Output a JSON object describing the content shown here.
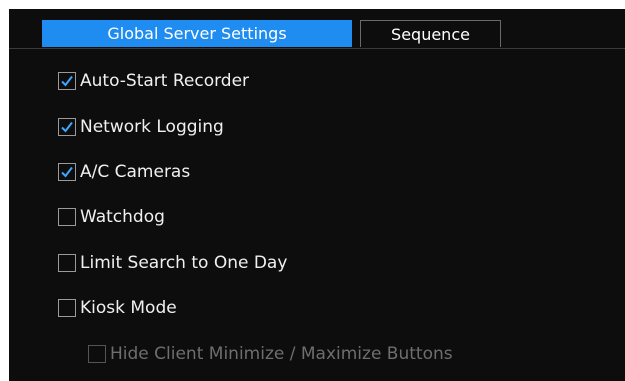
{
  "tabs": [
    {
      "label": "Global Server Settings",
      "active": true
    },
    {
      "label": "Sequence",
      "active": false
    }
  ],
  "options": [
    {
      "label": "Auto-Start Recorder",
      "checked": true,
      "enabled": true
    },
    {
      "label": "Network Logging",
      "checked": true,
      "enabled": true
    },
    {
      "label": "A/C Cameras",
      "checked": true,
      "enabled": true
    },
    {
      "label": "Watchdog",
      "checked": false,
      "enabled": true
    },
    {
      "label": "Limit Search to One Day",
      "checked": false,
      "enabled": true
    },
    {
      "label": "Kiosk Mode",
      "checked": false,
      "enabled": true
    },
    {
      "label": "Hide Client Minimize / Maximize Buttons",
      "checked": false,
      "enabled": false
    }
  ],
  "colors": {
    "background": "#0d0d0d",
    "active_tab": "#1e8cf0",
    "checkmark": "#3ea6ff",
    "text": "#f0f0f0",
    "disabled_text": "#6e6e6e"
  }
}
